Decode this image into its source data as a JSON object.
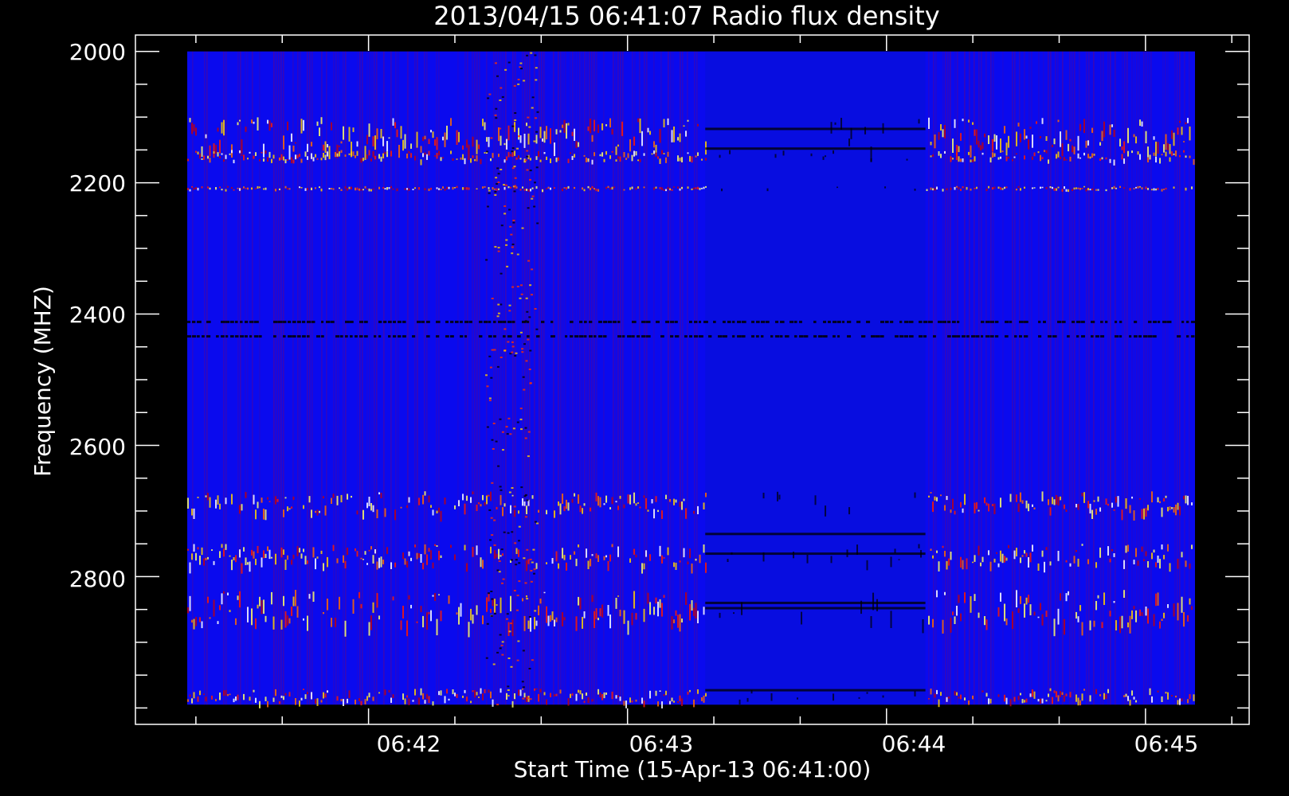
{
  "chart_data": {
    "type": "heatmap",
    "title": "2013/04/15 06:41:07 Radio flux density",
    "xlabel": "Start Time (15-Apr-13 06:41:00)",
    "ylabel": "Frequency (MHZ)",
    "x_tick_labels": [
      "06:42",
      "06:43",
      "06:44",
      "06:45"
    ],
    "x_tick_values_min": [
      1,
      2,
      3,
      4
    ],
    "x_minor_step_min": 0.3333,
    "xlim_min": [
      0.1,
      4.4
    ],
    "data_xlim_min": [
      0.3,
      4.3
    ],
    "y_tick_labels": [
      "2000",
      "2200",
      "2400",
      "2600",
      "2800"
    ],
    "y_tick_values": [
      2000,
      2200,
      2400,
      2600,
      2800
    ],
    "y_minor_step": 50,
    "ylim": [
      1975,
      3025
    ],
    "data_ylim": [
      2000,
      2995
    ],
    "y_reversed": true,
    "colormap": [
      "#000000",
      "#0000ff",
      "#ff0000",
      "#ffff00",
      "#ffffff"
    ],
    "background_color": "#0a0aee",
    "quiet_interval_min": [
      2.3,
      3.15
    ],
    "active_intervals_min": [
      [
        0.3,
        2.3
      ],
      [
        3.15,
        4.3
      ]
    ],
    "bright_bands_mhz": [
      [
        2100,
        2145
      ],
      [
        2150,
        2165
      ],
      [
        2205,
        2210
      ],
      [
        2670,
        2700
      ],
      [
        2750,
        2780
      ],
      [
        2820,
        2870
      ],
      [
        2970,
        2990
      ]
    ],
    "absorption_bands_mhz": [
      2412,
      2434
    ],
    "burst_column_min": [
      1.45,
      1.65
    ]
  }
}
